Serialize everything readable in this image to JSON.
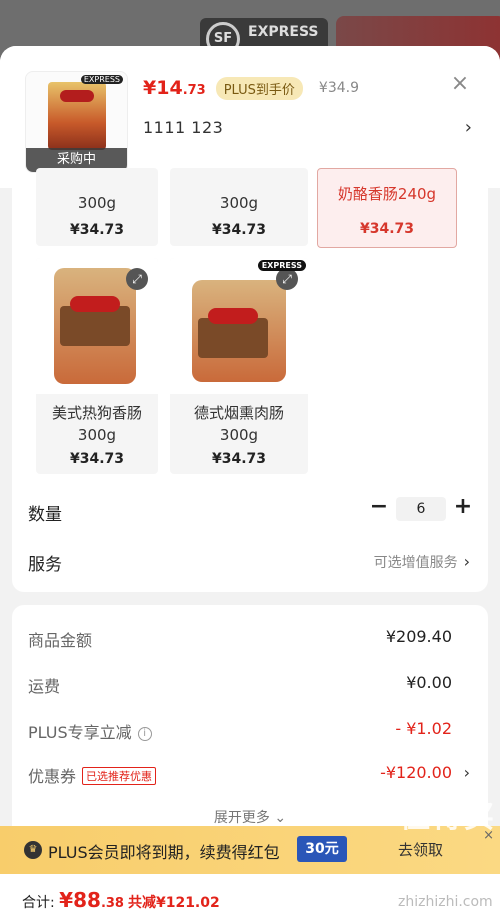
{
  "backdrop": {
    "badge_text": "EXPRESS",
    "sf_logo": "SF"
  },
  "header": {
    "thumb_overlay": "采购中",
    "thumb_badge": "EXPRESS",
    "price_symbol": "¥",
    "price_int": "14",
    "price_dec": ".73",
    "plus_tag": "PLUS到手价",
    "orig_price": "¥34.9",
    "selected_spec": "1111  123",
    "close_icon": "close-icon",
    "chevron": "›"
  },
  "specs": [
    {
      "name_line2": "300g",
      "price": "¥34.73",
      "selected": false
    },
    {
      "name_line2": "300g",
      "price": "¥34.73",
      "selected": false
    },
    {
      "name_line2": "奶酪香肠240g",
      "price": "¥34.73",
      "selected": true
    },
    {
      "name_line1": "美式热狗香肠",
      "name_line2": "300g",
      "price": "¥34.73",
      "selected": false
    },
    {
      "name_line1": "德式烟熏肉肠",
      "name_line2": "300g",
      "price": "¥34.73",
      "selected": false,
      "badge": "EXPRESS"
    }
  ],
  "quantity": {
    "label": "数量",
    "value": "6",
    "minus": "−",
    "plus": "+"
  },
  "service": {
    "label": "服务",
    "value": "可选增值服务",
    "chevron": "›"
  },
  "summary": {
    "goods_label": "商品金额",
    "goods_value": "¥209.40",
    "shipping_label": "运费",
    "shipping_value": "¥0.00",
    "plus_label": "PLUS专享立减",
    "plus_value": "- ¥1.02",
    "coupon_label": "优惠券",
    "coupon_tag": "已选推荐优惠",
    "coupon_value": "-¥120.00",
    "expand_label": "展开更多"
  },
  "banner": {
    "text": "PLUS会员即将到期，续费得红包",
    "amount": "30元",
    "claim": "去领取",
    "close": "×"
  },
  "footer": {
    "total_label": "合计: ",
    "total_symbol": "¥",
    "total_int": "88",
    "total_dec": ".38",
    "saved": "共减¥121.02"
  },
  "watermark": {
    "text": "值得买",
    "url": "zhizhizhi.com"
  },
  "colors": {
    "accent_red": "#e2231a",
    "plus_gold": "#f8cd6b",
    "blue_badge": "#2a56b8"
  }
}
